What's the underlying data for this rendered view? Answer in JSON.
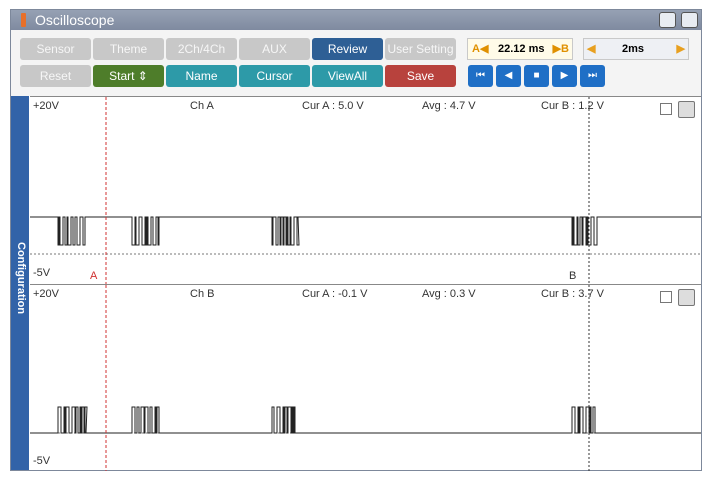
{
  "window": {
    "title": "Oscilloscope"
  },
  "toolbar": {
    "row1": [
      {
        "label": "Sensor",
        "style": "gray"
      },
      {
        "label": "Theme",
        "style": "gray"
      },
      {
        "label": "2Ch/4Ch",
        "style": "gray"
      },
      {
        "label": "AUX",
        "style": "gray"
      },
      {
        "label": "Review",
        "style": "blue"
      },
      {
        "label": "User Setting",
        "style": "gray"
      }
    ],
    "row2": [
      {
        "label": "Reset",
        "style": "gray"
      },
      {
        "label": "Start ⇕",
        "style": "green"
      },
      {
        "label": "Name",
        "style": "teal"
      },
      {
        "label": "Cursor",
        "style": "teal"
      },
      {
        "label": "ViewAll",
        "style": "teal"
      },
      {
        "label": "Save",
        "style": "red"
      }
    ],
    "cursor_a_marker": "A◀",
    "cursor_time": "22.12 ms",
    "cursor_b_marker": "▶B",
    "timebase": "2ms",
    "transport": [
      "⏮",
      "◀",
      "■",
      "▶",
      "⏭"
    ]
  },
  "sidebar": {
    "label": "Configuration"
  },
  "channels": [
    {
      "name": "Ch A",
      "vmax": "+20V",
      "vmin": "-5V",
      "cur_a": "Cur A : 5.0 V",
      "avg": "Avg : 4.7 V",
      "cur_b": "Cur B : 1.2 V",
      "cursor_a_label": "A",
      "cursor_b_label": "B"
    },
    {
      "name": "Ch B",
      "vmax": "+20V",
      "vmin": "-5V",
      "cur_a": "Cur A : -0.1 V",
      "avg": "Avg : 0.3 V",
      "cur_b": "Cur B : 3.7 V"
    }
  ],
  "colors": {
    "cursor_a": "#d03030",
    "cursor_b": "#333333",
    "trace": "#222222",
    "accent": "#3263a8"
  }
}
